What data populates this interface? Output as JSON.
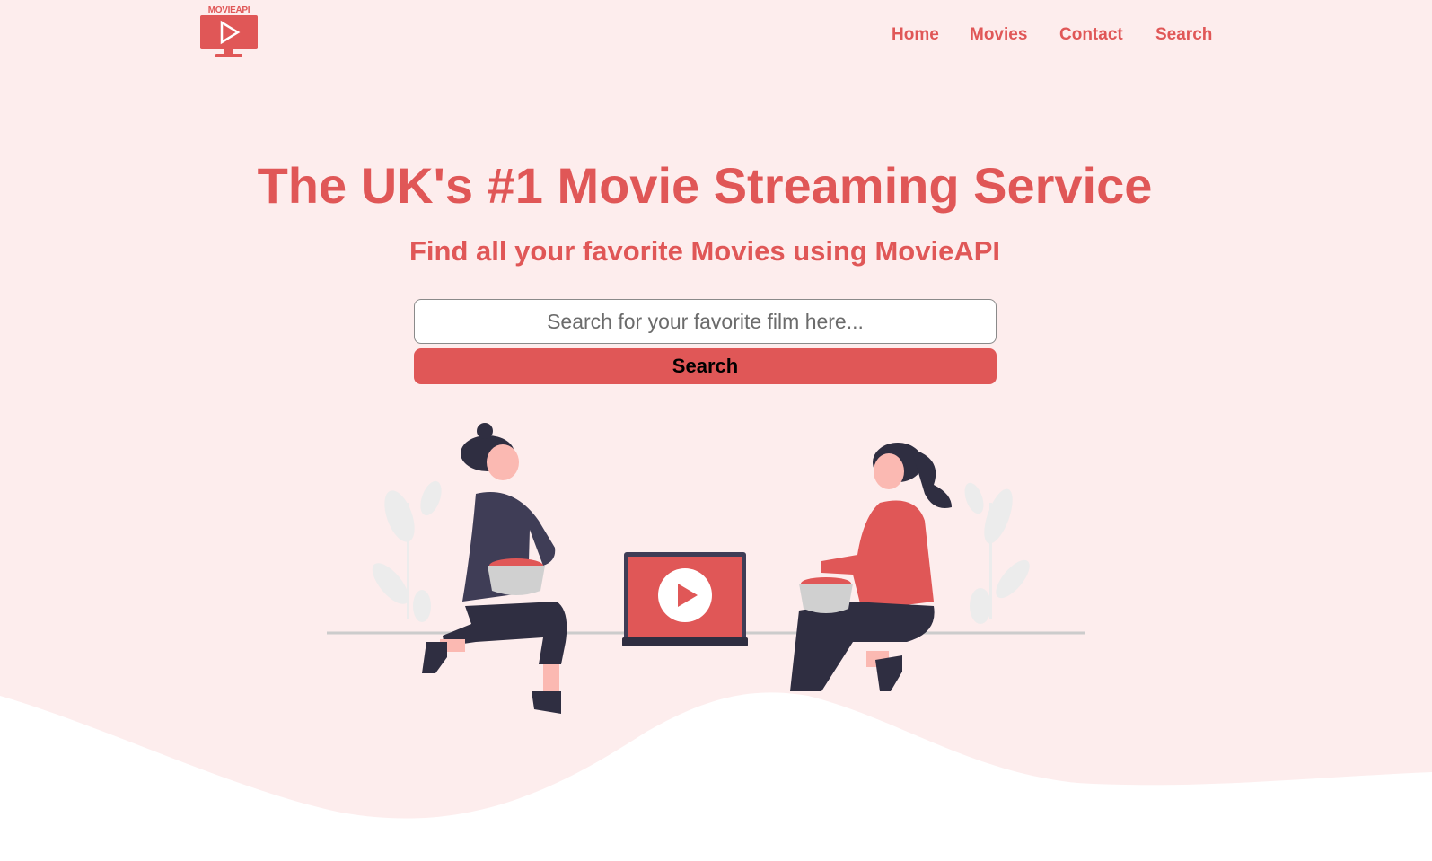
{
  "brand": {
    "logo_text": "MOVIEAPI",
    "accent_color": "#e05757",
    "background_color": "#fdeded"
  },
  "nav": {
    "items": [
      {
        "label": "Home"
      },
      {
        "label": "Movies"
      },
      {
        "label": "Contact"
      },
      {
        "label": "Search"
      }
    ]
  },
  "hero": {
    "title": "The UK's #1 Movie Streaming Service",
    "subtitle": "Find all your favorite Movies using MovieAPI",
    "search": {
      "placeholder": "Search for your favorite film here...",
      "value": "",
      "button_label": "Search"
    }
  },
  "illustration": {
    "icons": [
      "play-icon",
      "laptop-icon",
      "popcorn-bowl-icon"
    ]
  }
}
